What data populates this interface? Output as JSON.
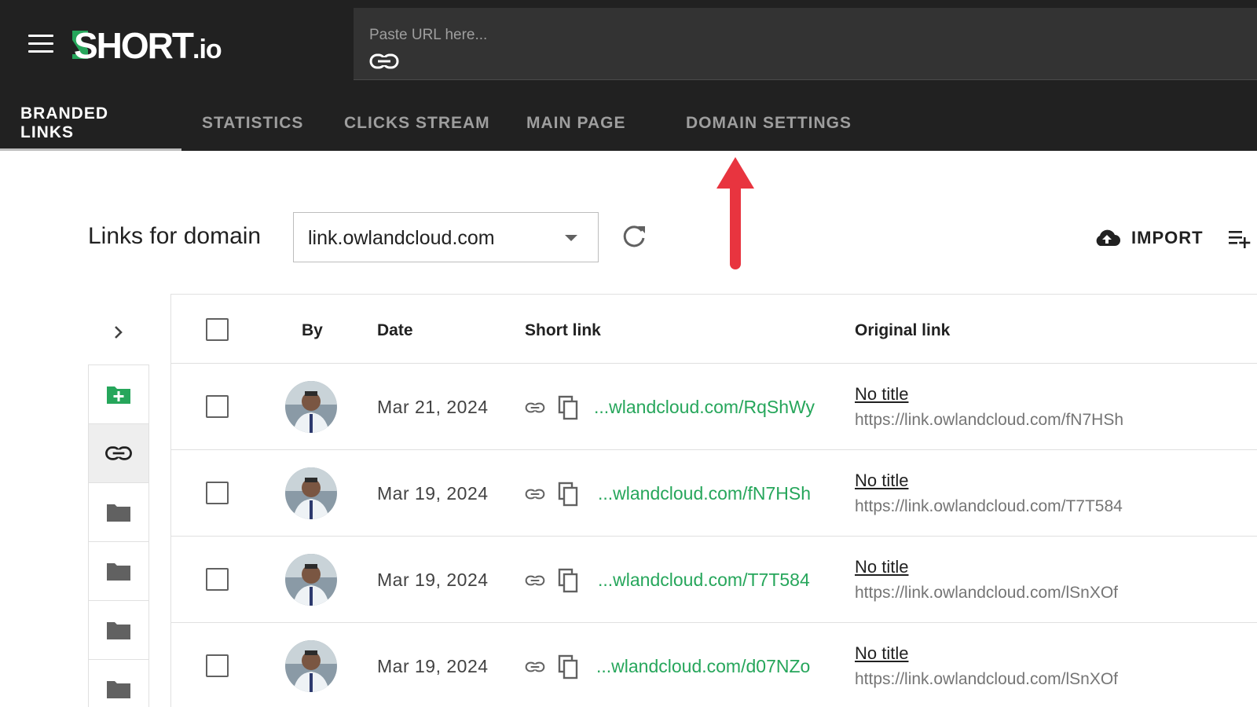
{
  "header": {
    "logo_text": "SHORT",
    "logo_suffix": ".io",
    "url_placeholder": "Paste URL here...",
    "tabs": [
      {
        "label": "BRANDED LINKS",
        "active": true
      },
      {
        "label": "STATISTICS",
        "active": false
      },
      {
        "label": "CLICKS STREAM",
        "active": false
      },
      {
        "label": "MAIN PAGE",
        "active": false
      },
      {
        "label": "DOMAIN SETTINGS",
        "active": false
      }
    ]
  },
  "toolbar": {
    "title": "Links for domain",
    "domain": "link.owlandcloud.com",
    "import_label": "IMPORT"
  },
  "table": {
    "columns": {
      "by": "By",
      "date": "Date",
      "short_link": "Short link",
      "original_link": "Original link"
    },
    "rows": [
      {
        "date": "Mar 21, 2024",
        "short_link": "...wlandcloud.com/RqShWy",
        "title": "No title",
        "original_url": "https://link.owlandcloud.com/fN7HSh"
      },
      {
        "date": "Mar 19, 2024",
        "short_link": "...wlandcloud.com/fN7HSh",
        "title": "No title",
        "original_url": "https://link.owlandcloud.com/T7T584"
      },
      {
        "date": "Mar 19, 2024",
        "short_link": "...wlandcloud.com/T7T584",
        "title": "No title",
        "original_url": "https://link.owlandcloud.com/lSnXOf"
      },
      {
        "date": "Mar 19, 2024",
        "short_link": "...wlandcloud.com/d07NZo",
        "title": "No title",
        "original_url": "https://link.owlandcloud.com/lSnXOf"
      }
    ]
  },
  "colors": {
    "header_bg": "#212121",
    "accent_green": "#26a65b",
    "annotation_red": "#e8343f"
  },
  "icons": [
    "menu-icon",
    "link-icon",
    "refresh-icon",
    "cloud-upload-icon",
    "playlist-add-icon",
    "chevron-right-icon",
    "folder-add-icon",
    "folder-icon",
    "copy-icon"
  ]
}
